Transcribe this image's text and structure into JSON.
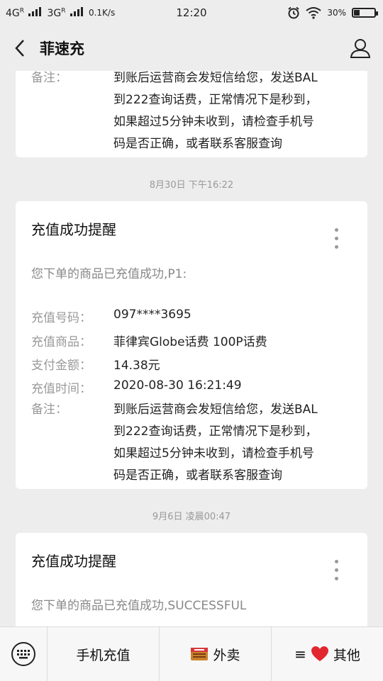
{
  "status_bar": {
    "net1": "4G",
    "net1_sup": "R",
    "net2": "3G",
    "net2_sup": "R",
    "speed": "0.1K/s",
    "time": "12:20",
    "battery": "30%",
    "battery_level": 0.3
  },
  "nav": {
    "title": "菲速充"
  },
  "messages": [
    {
      "partial": true,
      "note_label": "备注：",
      "note_lines": [
        "到账后运营商会发短信给您，发送BAL",
        "到222查询话费，正常情况下是秒到，",
        "如果超过5分钟未收到，请检查手机号",
        "码是否正确，或者联系客服查询"
      ]
    },
    {
      "time": "8月30日 下午16:22",
      "title": "充值成功提醒",
      "intro": "您下单的商品已充值成功,P1:",
      "rows": [
        {
          "label": "充值号码：",
          "value": "097****3695"
        },
        {
          "label": "充值商品：",
          "value": "菲律宾Globe话费 100P话费"
        },
        {
          "label": "支付金额：",
          "value": "14.38元"
        },
        {
          "label": "充值时间：",
          "value": "2020-08-30 16:21:49"
        }
      ],
      "note_label": "备注：",
      "note_lines": [
        "到账后运营商会发短信给您，发送BAL",
        "到222查询话费，正常情况下是秒到，",
        "如果超过5分钟未收到，请检查手机号",
        "码是否正确，或者联系客服查询"
      ]
    },
    {
      "time": "9月6日 凌晨00:47",
      "title": "充值成功提醒",
      "intro": "您下单的商品已充值成功,SUCCESSFUL"
    }
  ],
  "bottom_menu": {
    "item1": "手机充值",
    "item2": "外卖",
    "item3": "其他"
  },
  "colors": {
    "background": "#ededed",
    "card": "#ffffff",
    "text": "#222222",
    "muted": "#999999",
    "heart": "#e0282e"
  }
}
